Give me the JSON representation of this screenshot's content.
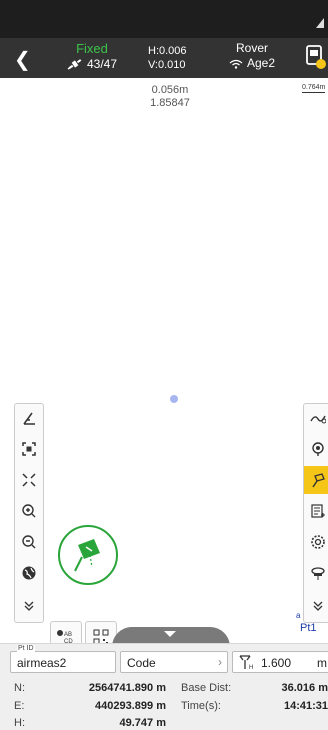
{
  "status": {
    "fix_state": "Fixed",
    "satellites": "43/47",
    "h_precision": "H:0.006",
    "v_precision": "V:0.010",
    "mode": "Rover",
    "age": "Age2"
  },
  "map": {
    "scale_text": "0.764m",
    "readout_distance": "0.056m",
    "readout_value": "1.85847",
    "point_label": "Pt1",
    "small_label": "a"
  },
  "panel": {
    "pt_id_label": "Pt ID",
    "pt_id_value": "airmeas2",
    "code_value": "Code",
    "antenna_height": "1.600",
    "antenna_unit": "m",
    "n_label": "N:",
    "n_value": "2564741.890 m",
    "e_label": "E:",
    "e_value": "440293.899 m",
    "h_label": "H:",
    "h_value": "49.747 m",
    "base_dist_label": "Base Dist:",
    "base_dist_value": "36.016 m",
    "time_label": "Time(s):",
    "time_value": "14:41:31"
  },
  "colors": {
    "fixed_green": "#3cc34a",
    "active_tool": "#f5c518",
    "topbar": "#333333"
  },
  "icons": {
    "left_tools": [
      "angle-icon",
      "zoom-frame-icon",
      "zoom-fit-icon",
      "zoom-in-icon",
      "zoom-out-icon",
      "globe-icon",
      "collapse-icon"
    ],
    "right_tools": [
      "trend-icon",
      "location-pin-icon",
      "survey-rod-icon",
      "layer-list-icon",
      "settings-icon",
      "receiver-icon",
      "collapse-icon"
    ]
  }
}
